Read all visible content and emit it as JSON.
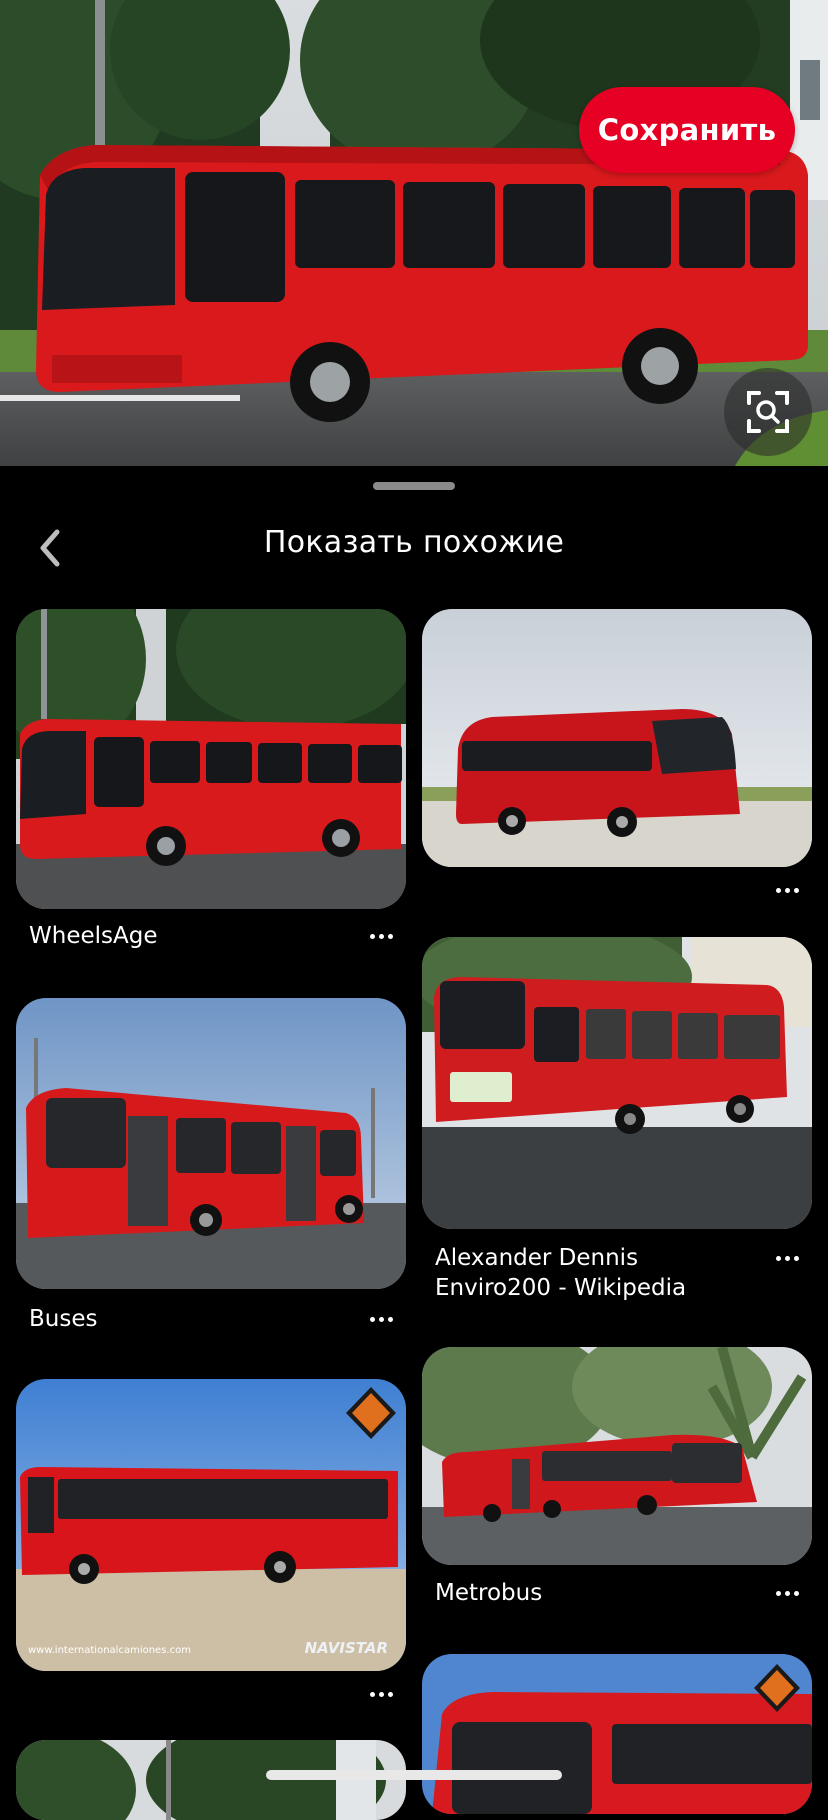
{
  "hero": {
    "save_label": "Сохранить",
    "visual_search_icon": "lens-search-icon",
    "accent": "#e60023"
  },
  "sheet": {
    "title": "Показать похожие",
    "back_icon": "chevron-left-icon"
  },
  "pins": [
    {
      "title": "WheelsAge",
      "image": "red-bus-photo"
    },
    {
      "title": "",
      "image": "red-coach-photo"
    },
    {
      "title": "Alexander Dennis Enviro200 - Wikipedia",
      "image": "red-bus-photo"
    },
    {
      "title": "Buses",
      "image": "red-double-door-bus-photo"
    },
    {
      "title": "Metrobus",
      "image": "red-articulated-bus-photo"
    },
    {
      "title": "",
      "image": "red-bus-navistar-photo",
      "watermark": "www.internationalcamiones.com",
      "brand": "NAVISTAR"
    },
    {
      "title": "",
      "image": "red-bus-front-photo"
    },
    {
      "title": "",
      "image": "trees-photo"
    }
  ]
}
